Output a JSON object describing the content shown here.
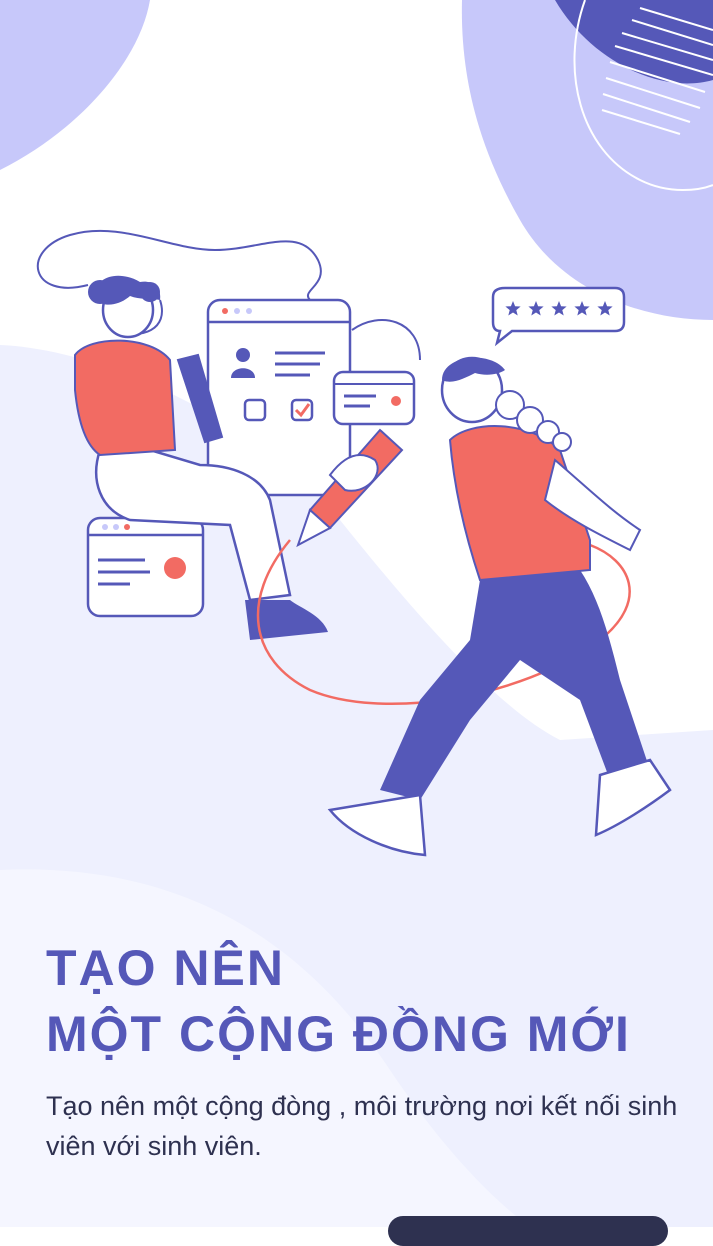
{
  "onboarding": {
    "title_line1": "TẠO NÊN",
    "title_line2": "MỘT CỘNG ĐỒNG MỚI",
    "description": "Tạo nên một cộng đòng , môi trường nơi kết nối sinh viên với sinh viên.",
    "rating_stars": 5
  },
  "colors": {
    "primary": "#5558B8",
    "accent": "#F26B63",
    "blob_light": "#C7C8FA",
    "blob_pale": "#EEF0FE",
    "text_dark": "#2E3150"
  },
  "icons": {
    "profile": "user-icon",
    "rating": "star-icon",
    "checkbox_checked": "check-icon",
    "pencil": "pencil-icon"
  }
}
